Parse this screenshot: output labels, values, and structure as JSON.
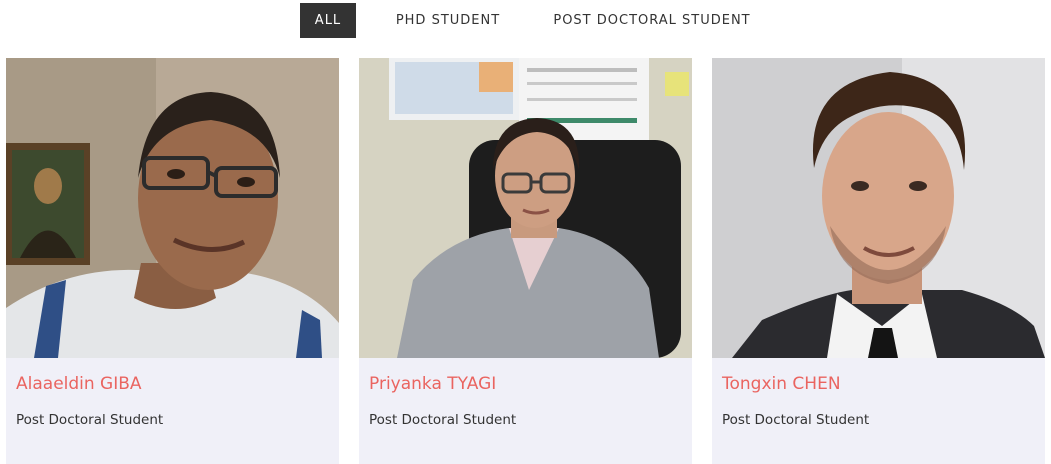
{
  "filters": [
    {
      "label": "ALL",
      "active": true
    },
    {
      "label": "PHD STUDENT",
      "active": false
    },
    {
      "label": "POST DOCTORAL STUDENT",
      "active": false
    }
  ],
  "people": [
    {
      "name": "Alaaeldin GIBA",
      "role": "Post Doctoral Student"
    },
    {
      "name": "Priyanka TYAGI",
      "role": "Post Doctoral Student"
    },
    {
      "name": "Tongxin CHEN",
      "role": "Post Doctoral Student"
    }
  ],
  "colors": {
    "accent_name": "#ea6460",
    "active_filter_bg": "#333333",
    "card_bg": "#f0f0f8"
  }
}
